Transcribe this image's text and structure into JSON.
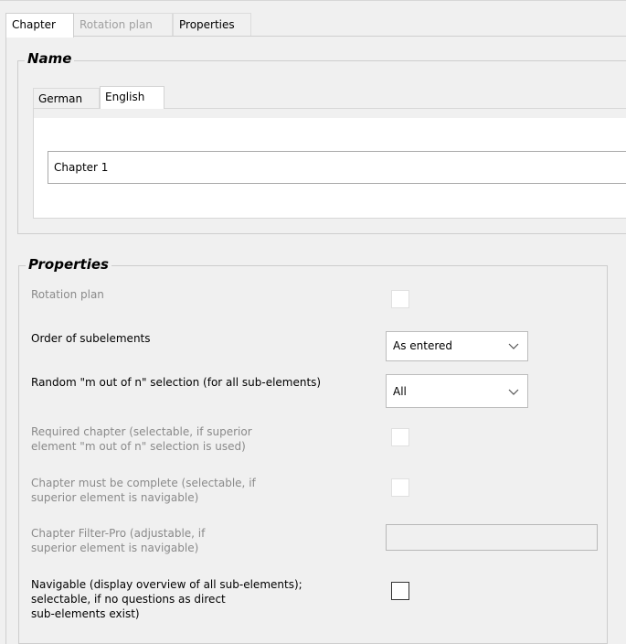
{
  "tabs": {
    "chapter": "Chapter",
    "rotation_plan": "Rotation plan",
    "properties": "Properties"
  },
  "name_group": {
    "title": "Name",
    "lang_tabs": {
      "german": "German",
      "english": "English"
    },
    "name_value": "Chapter 1"
  },
  "properties_group": {
    "title": "Properties",
    "rotation_plan_label": "Rotation plan",
    "order_label": "Order of subelements",
    "order_value": "As entered",
    "random_label": "Random \"m out of n\" selection (for all sub-elements)",
    "random_value": "All",
    "required_label_1": "Required chapter (selectable, if superior",
    "required_label_2": "element \"m out of n\" selection is used)",
    "complete_label_1": "Chapter must be complete (selectable, if",
    "complete_label_2": "superior element is navigable)",
    "filter_label_1": "Chapter Filter-Pro (adjustable, if",
    "filter_label_2": "superior element is navigable)",
    "navigable_label_1": "Navigable (display overview of all sub-elements);",
    "navigable_label_2": "selectable, if no questions as direct",
    "navigable_label_3": "sub-elements exist)"
  }
}
